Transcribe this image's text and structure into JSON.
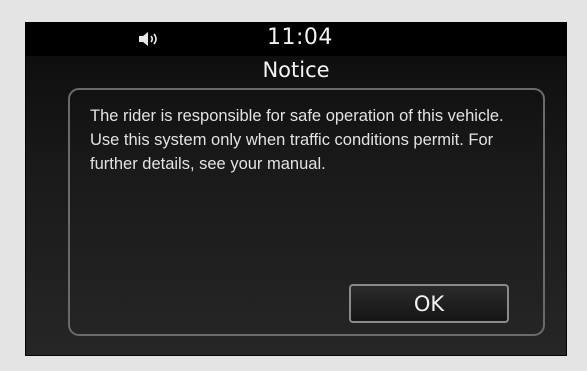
{
  "status_bar": {
    "volume_icon": "speaker-volume-icon",
    "time": "11:04"
  },
  "dialog": {
    "title": "Notice",
    "message": "The rider is responsible for safe operation of this vehicle. Use this system only when traffic conditions permit. For further details, see your manual.",
    "ok_label": "OK"
  },
  "colors": {
    "status_bar_bg": "#000000",
    "text": "#f2f2f2",
    "dialog_border": "#6a6a6a",
    "button_border": "#8a8a8a"
  }
}
